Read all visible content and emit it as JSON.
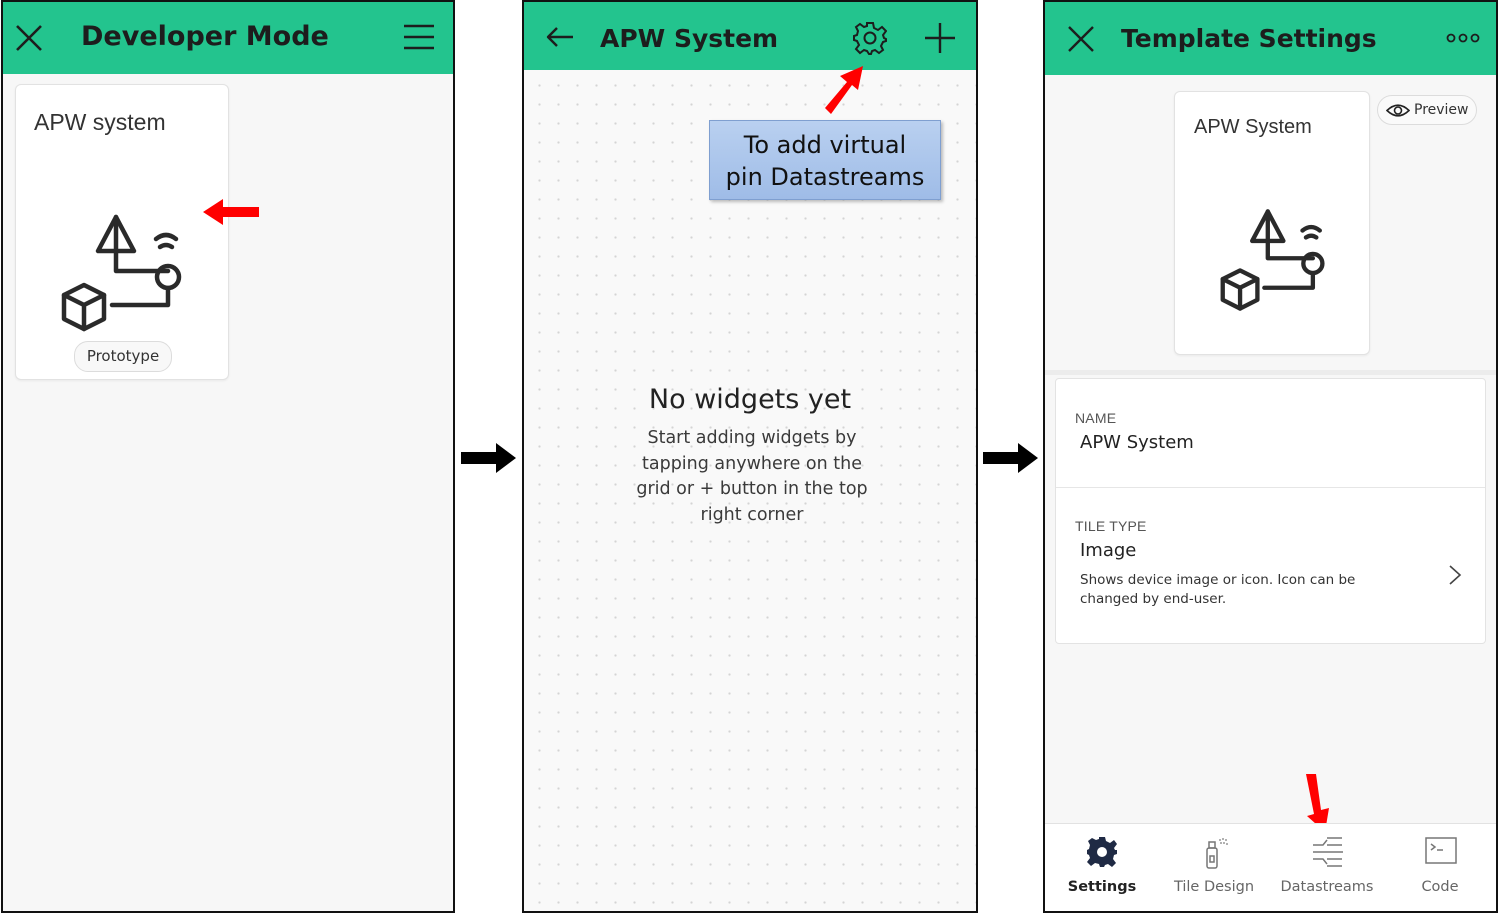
{
  "panel1": {
    "title": "Developer Mode",
    "card": {
      "title": "APW system",
      "badge": "Prototype"
    },
    "icons": {
      "close": "close-icon",
      "menu": "hamburger-menu-icon",
      "device": "device-prototype-icon"
    }
  },
  "panel2": {
    "title": "APW System",
    "tooltip": {
      "line1": "To add virtual",
      "line2": "pin Datastreams"
    },
    "empty": {
      "title": "No widgets yet",
      "line1": "Start adding widgets by",
      "line2": "tapping anywhere on the",
      "line3": "grid or + button in the top",
      "line4": "right corner"
    },
    "icons": {
      "back": "back-arrow-icon",
      "settings": "gear-icon",
      "add": "plus-icon"
    }
  },
  "panel3": {
    "title": "Template Settings",
    "preview_label": "Preview",
    "tile": {
      "title": "APW System"
    },
    "name": {
      "label": "NAME",
      "value": "APW System"
    },
    "tile_type": {
      "label": "TILE TYPE",
      "value": "Image",
      "desc_line1": "Shows device image or icon. Icon can be",
      "desc_line2": "changed by end-user."
    },
    "tabs": [
      {
        "label": "Settings",
        "icon": "gear-icon",
        "active": true
      },
      {
        "label": "Tile Design",
        "icon": "spray-icon",
        "active": false
      },
      {
        "label": "Datastreams",
        "icon": "datastreams-icon",
        "active": false
      },
      {
        "label": "Code",
        "icon": "terminal-icon",
        "active": false
      }
    ],
    "icons": {
      "close": "close-icon",
      "more": "more-dots-icon",
      "preview": "eye-icon"
    }
  },
  "colors": {
    "header_green": "#23c48e",
    "annotation_red": "#ff0000",
    "tooltip_blue": "#a9c4ec",
    "tab_active": "#1f2a44"
  }
}
